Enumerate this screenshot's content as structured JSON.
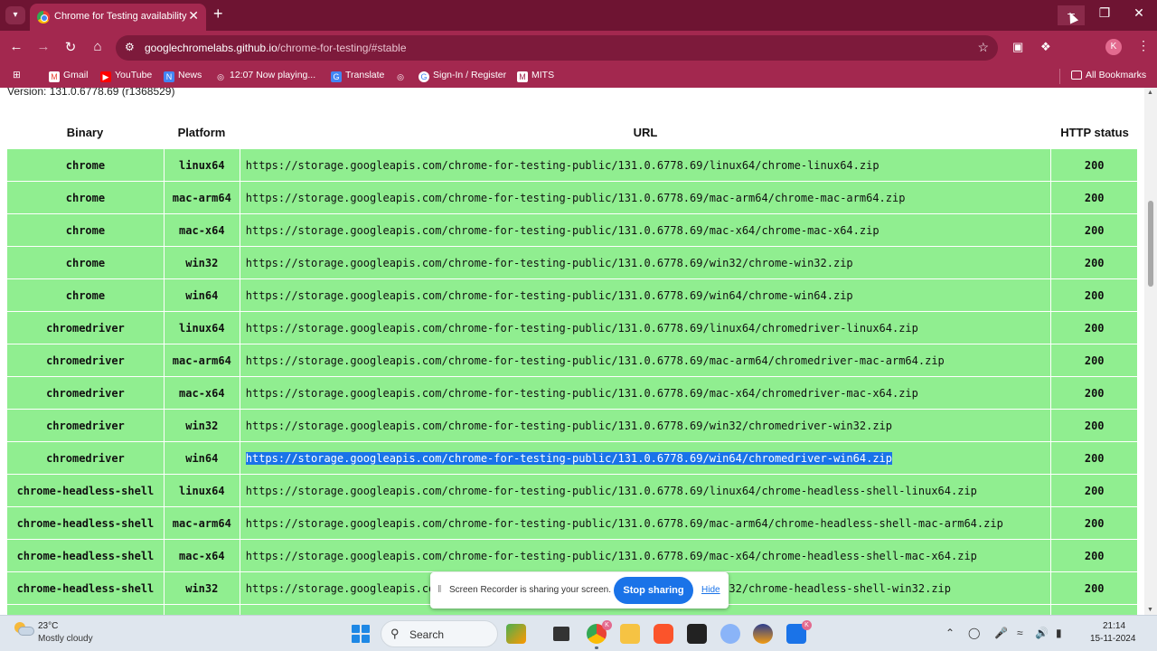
{
  "browser": {
    "tab_title": "Chrome for Testing availability",
    "url_host": "googlechromelabs.github.io",
    "url_path": "/chrome-for-testing/#stable",
    "profile_initial": "K"
  },
  "bookmarks": [
    {
      "label": "Gmail",
      "icon": "gmail-icon"
    },
    {
      "label": "YouTube",
      "icon": "youtube-icon"
    },
    {
      "label": "News",
      "icon": "news-icon"
    },
    {
      "label": "12:07 Now playing...",
      "icon": "globe-icon"
    },
    {
      "label": "Translate",
      "icon": "translate-icon"
    },
    {
      "label": "",
      "icon": "globe-icon"
    },
    {
      "label": "Sign-In / Register",
      "icon": "google-icon"
    },
    {
      "label": "MITS",
      "icon": "mits-icon"
    }
  ],
  "all_bookmarks": "All Bookmarks",
  "page": {
    "version": "Version: 131.0.6778.69 (r1368529)",
    "headers": {
      "binary": "Binary",
      "platform": "Platform",
      "url": "URL",
      "status": "HTTP status"
    },
    "rows": [
      {
        "binary": "chrome",
        "platform": "linux64",
        "url": "https://storage.googleapis.com/chrome-for-testing-public/131.0.6778.69/linux64/chrome-linux64.zip",
        "status": "200"
      },
      {
        "binary": "chrome",
        "platform": "mac-arm64",
        "url": "https://storage.googleapis.com/chrome-for-testing-public/131.0.6778.69/mac-arm64/chrome-mac-arm64.zip",
        "status": "200"
      },
      {
        "binary": "chrome",
        "platform": "mac-x64",
        "url": "https://storage.googleapis.com/chrome-for-testing-public/131.0.6778.69/mac-x64/chrome-mac-x64.zip",
        "status": "200"
      },
      {
        "binary": "chrome",
        "platform": "win32",
        "url": "https://storage.googleapis.com/chrome-for-testing-public/131.0.6778.69/win32/chrome-win32.zip",
        "status": "200"
      },
      {
        "binary": "chrome",
        "platform": "win64",
        "url": "https://storage.googleapis.com/chrome-for-testing-public/131.0.6778.69/win64/chrome-win64.zip",
        "status": "200"
      },
      {
        "binary": "chromedriver",
        "platform": "linux64",
        "url": "https://storage.googleapis.com/chrome-for-testing-public/131.0.6778.69/linux64/chromedriver-linux64.zip",
        "status": "200"
      },
      {
        "binary": "chromedriver",
        "platform": "mac-arm64",
        "url": "https://storage.googleapis.com/chrome-for-testing-public/131.0.6778.69/mac-arm64/chromedriver-mac-arm64.zip",
        "status": "200"
      },
      {
        "binary": "chromedriver",
        "platform": "mac-x64",
        "url": "https://storage.googleapis.com/chrome-for-testing-public/131.0.6778.69/mac-x64/chromedriver-mac-x64.zip",
        "status": "200"
      },
      {
        "binary": "chromedriver",
        "platform": "win32",
        "url": "https://storage.googleapis.com/chrome-for-testing-public/131.0.6778.69/win32/chromedriver-win32.zip",
        "status": "200"
      },
      {
        "binary": "chromedriver",
        "platform": "win64",
        "url": "https://storage.googleapis.com/chrome-for-testing-public/131.0.6778.69/win64/chromedriver-win64.zip",
        "status": "200",
        "selected": true
      },
      {
        "binary": "chrome-headless-shell",
        "platform": "linux64",
        "url": "https://storage.googleapis.com/chrome-for-testing-public/131.0.6778.69/linux64/chrome-headless-shell-linux64.zip",
        "status": "200"
      },
      {
        "binary": "chrome-headless-shell",
        "platform": "mac-arm64",
        "url": "https://storage.googleapis.com/chrome-for-testing-public/131.0.6778.69/mac-arm64/chrome-headless-shell-mac-arm64.zip",
        "status": "200"
      },
      {
        "binary": "chrome-headless-shell",
        "platform": "mac-x64",
        "url": "https://storage.googleapis.com/chrome-for-testing-public/131.0.6778.69/mac-x64/chrome-headless-shell-mac-x64.zip",
        "status": "200"
      },
      {
        "binary": "chrome-headless-shell",
        "platform": "win32",
        "url": "https://storage.googleapis.com/chrome-for-testing-public/131.0.6778.69/win32/chrome-headless-shell-win32.zip",
        "status": "200"
      },
      {
        "binary": "",
        "platform": "",
        "url": "",
        "status": ""
      }
    ],
    "cell_color": "#90ee90",
    "selection_color": "#1a73e8"
  },
  "recorder": {
    "message": "Screen Recorder is sharing your screen.",
    "stop_label": "Stop sharing",
    "hide_label": "Hide"
  },
  "taskbar": {
    "temperature": "23°C",
    "weather": "Mostly cloudy",
    "search_label": "Search",
    "time": "21:14",
    "date": "15-11-2024"
  },
  "colors": {
    "titlebar": "#6e1432",
    "toolbar": "#a3284f"
  }
}
